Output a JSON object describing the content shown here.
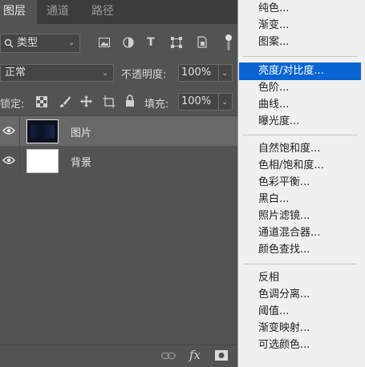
{
  "tabs": [
    {
      "label": "图层",
      "active": true
    },
    {
      "label": "通道",
      "active": false
    },
    {
      "label": "路径",
      "active": false
    }
  ],
  "filter": {
    "label": "类型"
  },
  "blend_mode": {
    "value": "正常"
  },
  "opacity": {
    "label": "不透明度:",
    "value": "100%"
  },
  "lock": {
    "label": "锁定:"
  },
  "fill": {
    "label": "填充:",
    "value": "100%"
  },
  "layers": [
    {
      "name": "图片",
      "selected": true
    },
    {
      "name": "背景",
      "selected": false
    }
  ],
  "bottom_bar": {
    "fx_label": "fx"
  },
  "menu": {
    "highlight_color": "#0a64d2",
    "groups": [
      [
        "纯色...",
        "渐变...",
        "图案..."
      ],
      [
        "亮度/对比度...",
        "色阶...",
        "曲线...",
        "曝光度..."
      ],
      [
        "自然饱和度...",
        "色相/饱和度...",
        "色彩平衡...",
        "黑白...",
        "照片滤镜...",
        "通道混合器...",
        "颜色查找..."
      ],
      [
        "反相",
        "色调分离...",
        "阈值...",
        "渐变映射...",
        "可选颜色..."
      ]
    ],
    "highlighted": "亮度/对比度..."
  }
}
